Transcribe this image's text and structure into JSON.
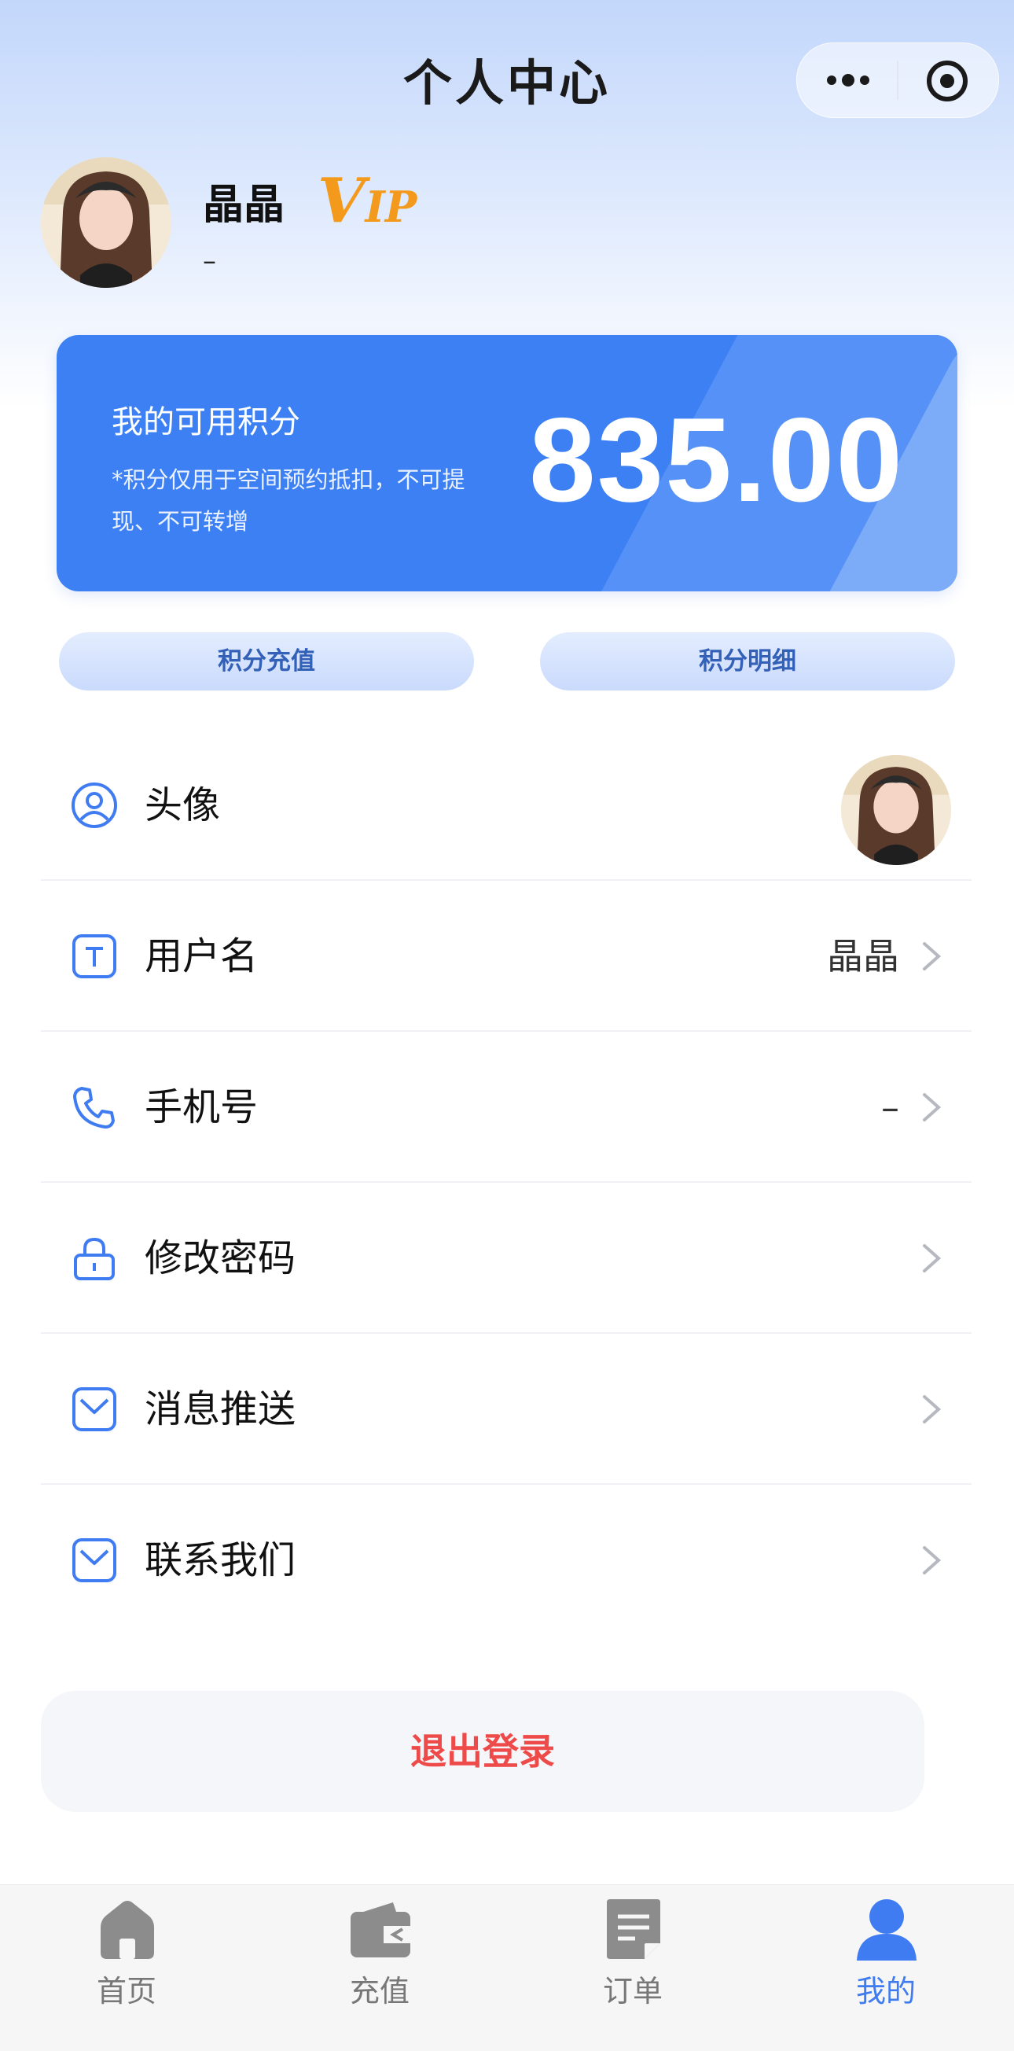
{
  "nav": {
    "title": "个人中心"
  },
  "profile": {
    "name": "晶晶",
    "vip_badge_v": "V",
    "vip_badge_ip": "IP",
    "phone": "–"
  },
  "points_card": {
    "label": "我的可用积分",
    "note": "*积分仅用于空间预约抵扣，不可提现、不可转增",
    "value": "835.00"
  },
  "actions": {
    "recharge": "积分充值",
    "details": "积分明细"
  },
  "menu": [
    {
      "label": "头像",
      "value": "",
      "icon": "user-circle-icon"
    },
    {
      "label": "用户名",
      "value": "晶晶",
      "icon": "text-t-icon"
    },
    {
      "label": "手机号",
      "value": "–",
      "icon": "phone-icon"
    },
    {
      "label": "修改密码",
      "value": "",
      "icon": "lock-icon"
    },
    {
      "label": "消息推送",
      "value": "",
      "icon": "mail-icon"
    },
    {
      "label": "联系我们",
      "value": "",
      "icon": "mail-icon"
    }
  ],
  "logout": {
    "label": "退出登录"
  },
  "tabbar": [
    {
      "label": "首页",
      "icon": "home-icon",
      "active": false
    },
    {
      "label": "充值",
      "icon": "wallet-icon",
      "active": false
    },
    {
      "label": "订单",
      "icon": "document-icon",
      "active": false
    },
    {
      "label": "我的",
      "icon": "user-icon",
      "active": true
    }
  ],
  "colors": {
    "accent": "#3f7bf1",
    "card": "#3d80f4",
    "vip": "#f39a1c",
    "logout": "#ef4a4a",
    "tab_inactive": "#777777"
  }
}
